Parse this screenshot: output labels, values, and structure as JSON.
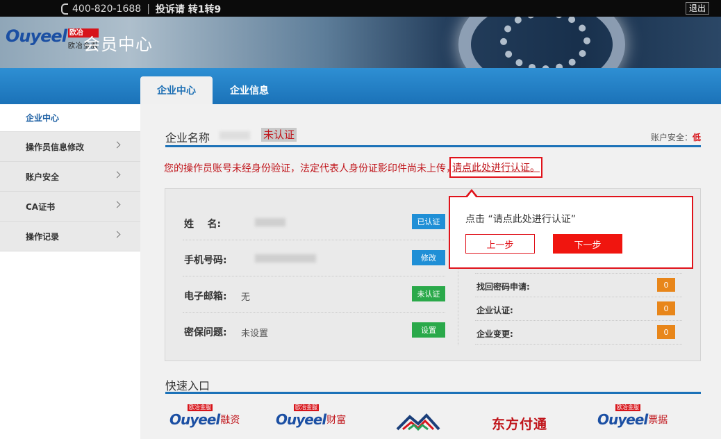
{
  "topbar": {
    "phone": "400-820-1688",
    "separator": "|",
    "complaint": "投诉请 转1转9",
    "logout": "退出"
  },
  "banner": {
    "logo_word": "Ouyeel",
    "logo_badge": "欧冶",
    "logo_sub": "欧冶金服",
    "title": "会员中心"
  },
  "nav": {
    "tabs": [
      {
        "label": "企业中心",
        "active": true
      },
      {
        "label": "企业信息",
        "active": false
      }
    ]
  },
  "sidebar": {
    "items": [
      {
        "label": "企业中心"
      },
      {
        "label": "操作员信息修改"
      },
      {
        "label": "账户安全"
      },
      {
        "label": "CA证书"
      },
      {
        "label": "操作记录"
      }
    ]
  },
  "company": {
    "label": "企业名称",
    "status": "未认证",
    "safety_label": "账户安全：",
    "safety_value": "低"
  },
  "warning": {
    "text": "您的操作员账号未经身份验证，法定代表人身份证影印件尚未上传，",
    "link": "请点此处进行认证。"
  },
  "info_rows": [
    {
      "key": "姓    名:",
      "value": "",
      "button": "已认证",
      "button_color": "#1f8fd6"
    },
    {
      "key": "手机号码:",
      "value": "",
      "button": "修改",
      "button_color": "#1f8fd6"
    },
    {
      "key": "电子邮箱:",
      "value": "无",
      "button": "未认证",
      "button_color": "#2aa94a"
    },
    {
      "key": "密保问题:",
      "value": "未设置",
      "button": "设置",
      "button_color": "#2aa94a"
    }
  ],
  "right_rows": [
    {
      "key": "找回密码申请:",
      "count": "0"
    },
    {
      "key": "企业认证:",
      "count": "0"
    },
    {
      "key": "企业变更:",
      "count": "0"
    }
  ],
  "popup": {
    "text": "点击 “请点此处进行认证”",
    "prev": "上一步",
    "next": "下一步"
  },
  "quick": {
    "title": "快速入口",
    "links": [
      {
        "word": "Ouyeel",
        "suffix": "融资",
        "badge": "欧冶金服"
      },
      {
        "word": "Ouyeel",
        "suffix": "财富",
        "badge": "欧冶金服"
      },
      {
        "word": "东方付通"
      },
      {
        "word": "Ouyeel",
        "suffix": "票据",
        "badge": "欧冶金服"
      }
    ]
  }
}
